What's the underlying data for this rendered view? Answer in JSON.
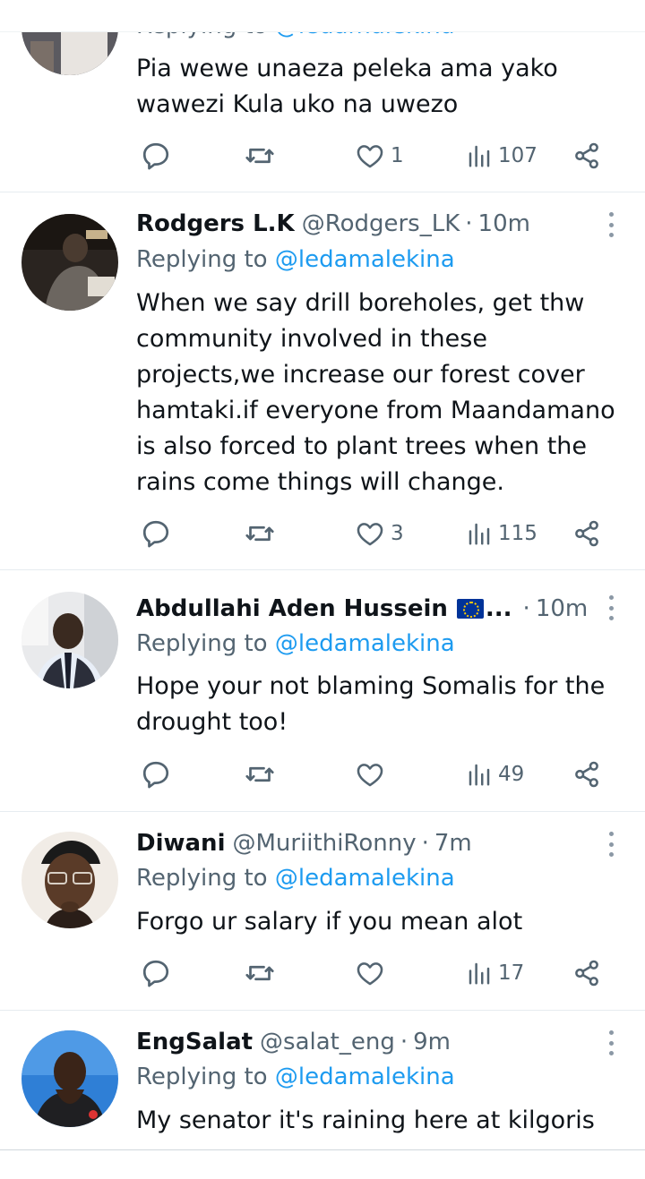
{
  "tweets": [
    {
      "reply_prefix": "Replying to",
      "mention": "@ledamalekina",
      "text": "Pia wewe unaeza peleka ama yako wawezi Kula uko na uwezo",
      "likes": "1",
      "views": "107"
    },
    {
      "name": "Rodgers L.K",
      "handle": "@Rodgers_LK",
      "sep": "·",
      "time": "10m",
      "reply_prefix": "Replying to",
      "mention": "@ledamalekina",
      "text": "When we say drill boreholes, get thw community involved in these projects,we increase our forest cover hamtaki.if everyone from Maandamano is also forced to plant trees when the rains come things will change.",
      "likes": "3",
      "views": "115"
    },
    {
      "name": "Abdullahi Aden Hussein",
      "ellipsis": "...",
      "sep": "·",
      "time": "10m",
      "reply_prefix": "Replying to",
      "mention": "@ledamalekina",
      "text": "Hope your not blaming Somalis for the drought too!",
      "likes": "",
      "views": "49"
    },
    {
      "name": "Diwani",
      "handle": "@MuriithiRonny",
      "sep": "·",
      "time": "7m",
      "reply_prefix": "Replying to",
      "mention": "@ledamalekina",
      "text": "Forgo ur salary if you mean alot",
      "likes": "",
      "views": "17"
    },
    {
      "name": "EngSalat",
      "handle": "@salat_eng",
      "sep": "·",
      "time": "9m",
      "reply_prefix": "Replying to",
      "mention": "@ledamalekina",
      "text": "My senator it's raining here at kilgoris"
    }
  ],
  "icons": {
    "reply": "reply-icon",
    "retweet": "retweet-icon",
    "like": "heart-icon",
    "views": "views-icon",
    "share": "share-icon",
    "more": "more-icon"
  },
  "colors": {
    "link": "#1d9bf0",
    "secondary": "#536471",
    "text": "#0f1419"
  }
}
